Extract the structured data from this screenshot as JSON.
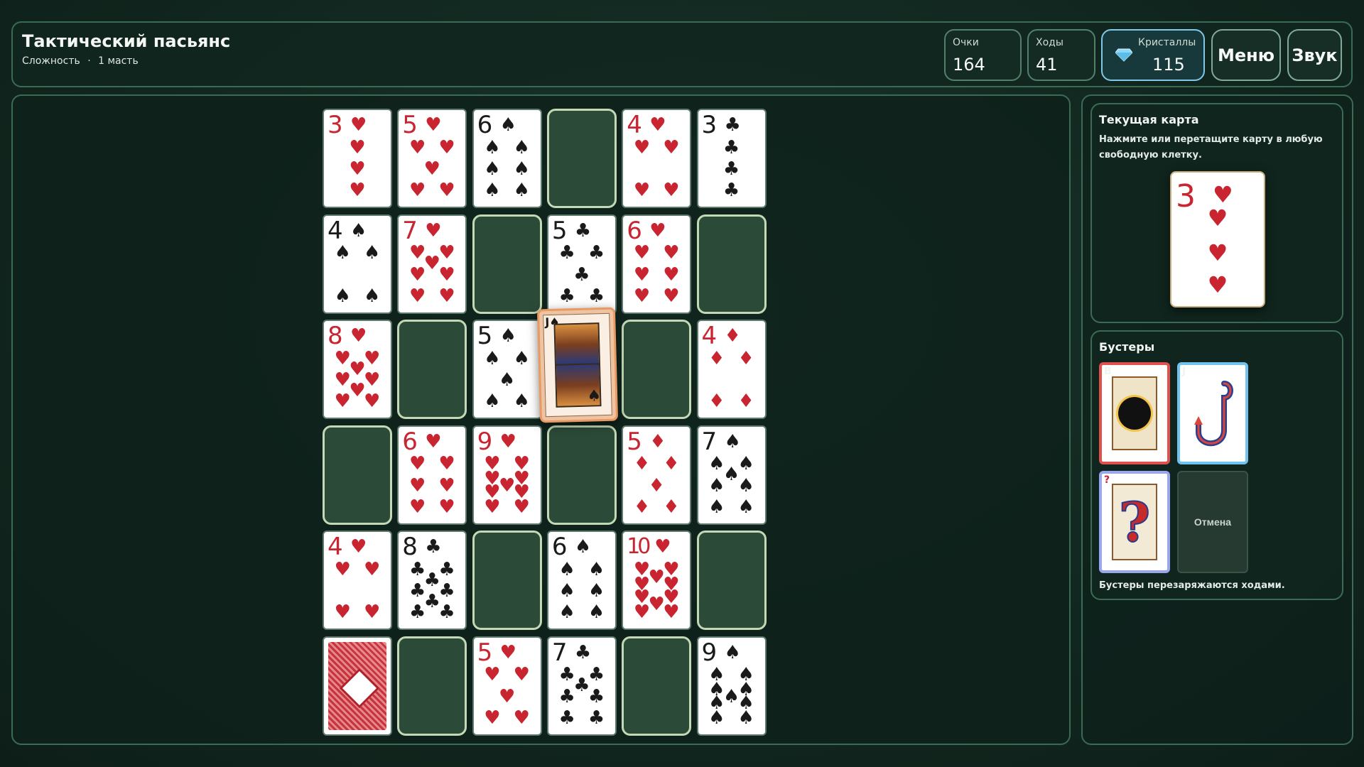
{
  "header": {
    "title": "Тактический пасьянс",
    "subtitle_left": "Сложность",
    "subtitle_sep": "·",
    "subtitle_right": "1 масть"
  },
  "stats": {
    "score_label": "Очки",
    "score_value": "164",
    "moves_label": "Ходы",
    "moves_value": "41",
    "crystals_label": "Кристаллы",
    "crystals_value": "115"
  },
  "buttons": {
    "menu": "Меню",
    "sound": "Звук"
  },
  "board": {
    "rows": 6,
    "cols": 6,
    "cells": [
      [
        {
          "rank": "3",
          "suit": "♥"
        },
        {
          "rank": "5",
          "suit": "♥"
        },
        {
          "rank": "6",
          "suit": "♠"
        },
        {
          "empty": true
        },
        {
          "rank": "4",
          "suit": "♥"
        },
        {
          "rank": "3",
          "suit": "♣"
        }
      ],
      [
        {
          "rank": "4",
          "suit": "♠"
        },
        {
          "rank": "7",
          "suit": "♥"
        },
        {
          "empty": true
        },
        {
          "rank": "5",
          "suit": "♣"
        },
        {
          "rank": "6",
          "suit": "♥"
        },
        {
          "empty": true
        }
      ],
      [
        {
          "rank": "8",
          "suit": "♥"
        },
        {
          "empty": true
        },
        {
          "rank": "5",
          "suit": "♠"
        },
        {
          "jack": true
        },
        {
          "empty": true
        },
        {
          "rank": "4",
          "suit": "♦"
        }
      ],
      [
        {
          "empty": true
        },
        {
          "rank": "6",
          "suit": "♥"
        },
        {
          "rank": "9",
          "suit": "♥"
        },
        {
          "empty": true
        },
        {
          "rank": "5",
          "suit": "♦"
        },
        {
          "rank": "7",
          "suit": "♠"
        }
      ],
      [
        {
          "rank": "4",
          "suit": "♥"
        },
        {
          "rank": "8",
          "suit": "♣"
        },
        {
          "empty": true
        },
        {
          "rank": "6",
          "suit": "♠"
        },
        {
          "rank": "10",
          "suit": "♥"
        },
        {
          "empty": true
        }
      ],
      [
        {
          "back": true
        },
        {
          "empty": true
        },
        {
          "rank": "5",
          "suit": "♥"
        },
        {
          "rank": "7",
          "suit": "♣"
        },
        {
          "empty": true
        },
        {
          "rank": "9",
          "suit": "♠"
        }
      ]
    ],
    "jack_card": {
      "rank": "J",
      "suit": "♠",
      "icon": "jack-of-spades-icon"
    }
  },
  "current": {
    "title": "Текущая карта",
    "hint": "Нажмите или перетащите карту в любую свободную клетку.",
    "card_rank": "3",
    "card_suit": "♥"
  },
  "boosters": {
    "title": "Бустеры",
    "items": [
      {
        "name": "bomb",
        "icon": "bomb-icon",
        "corner": "B"
      },
      {
        "name": "hook",
        "icon": "hook-icon",
        "corner": "J"
      },
      {
        "name": "question",
        "icon": "question-icon",
        "corner": "?"
      }
    ],
    "cancel": "Отмена",
    "hint": "Бустеры перезаряжаются ходами."
  },
  "colors": {
    "red_suit": "#c82531",
    "black_suit": "#1a1a1a",
    "empty_slot": "#2c4a38",
    "empty_border": "#c3d9b5",
    "accent_crystal": "#7fc8e8"
  }
}
